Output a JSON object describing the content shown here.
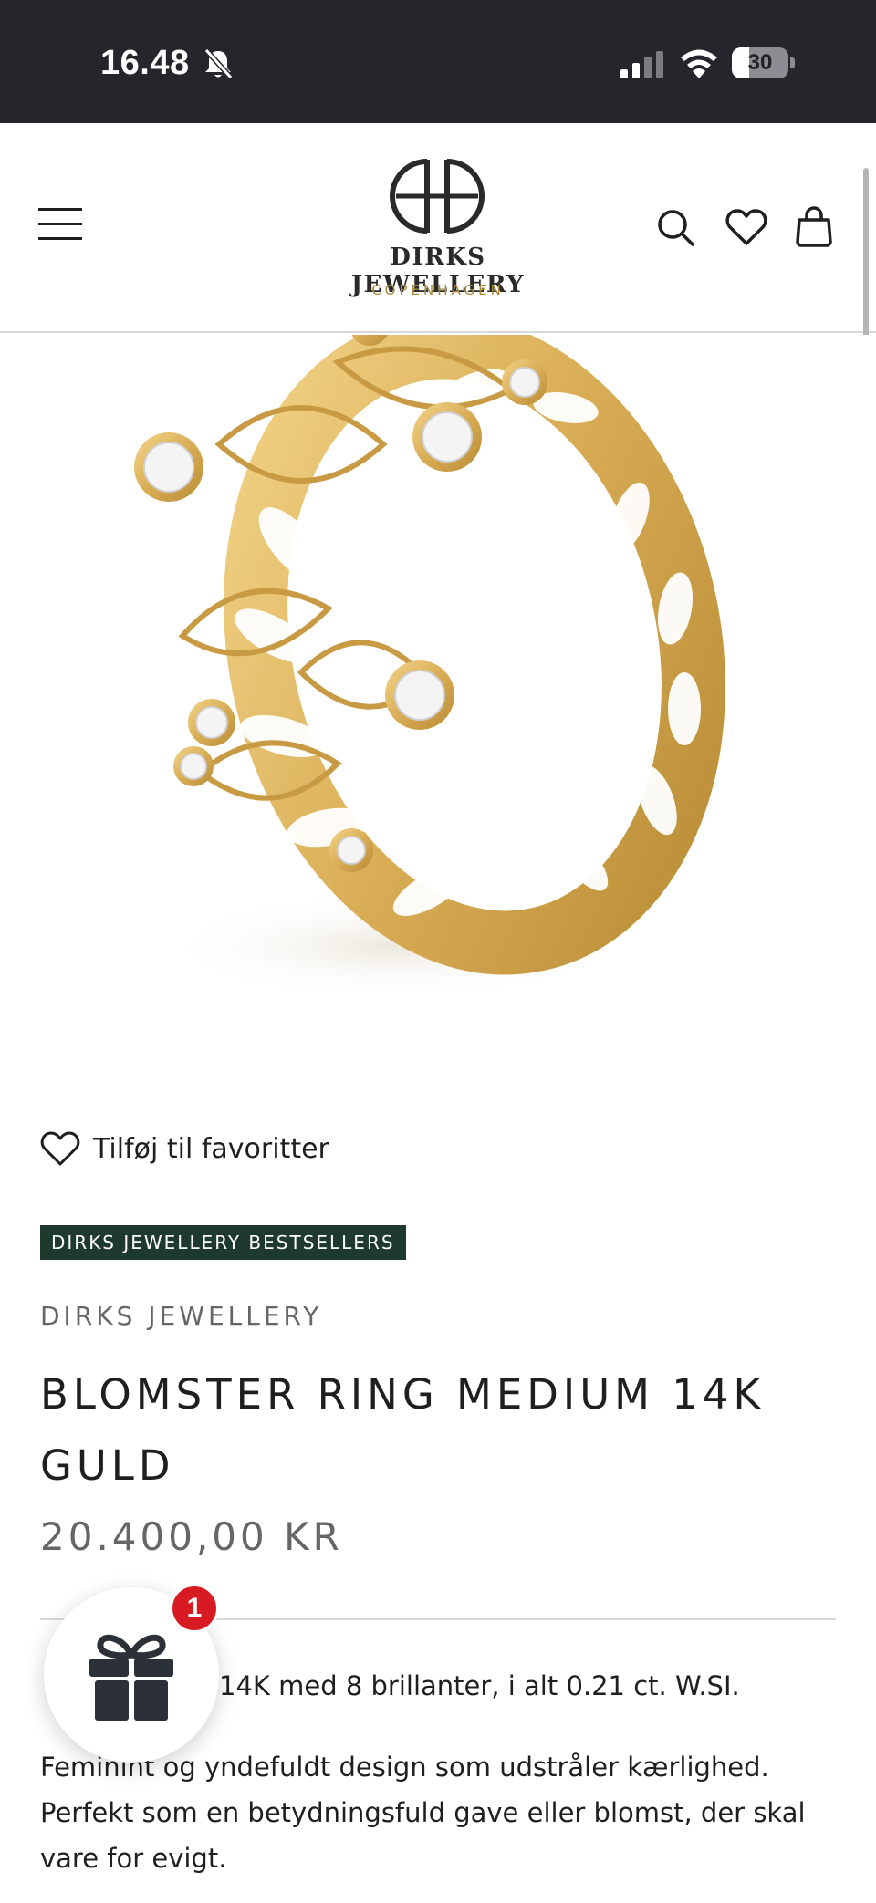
{
  "status_bar": {
    "time": "16.48",
    "battery_level": "30",
    "battery_fraction": 0.3
  },
  "header": {
    "logo_name": "DIRKS JEWELLERY",
    "logo_city": "COPENHAGEN",
    "icons": [
      "menu-icon",
      "search-icon",
      "heart-icon",
      "bag-icon"
    ]
  },
  "product": {
    "favorite_label": "Tilføj til favoritter",
    "collection_badge": "DIRKS JEWELLERY BESTSELLERS",
    "vendor": "DIRKS JEWELLERY",
    "title": "BLOMSTER RING MEDIUM 14K GULD",
    "price": "20.400,00 KR",
    "description_short": "14K med 8 brillanter, i alt 0.21 ct. W.SI.",
    "description_long": "Feminint og yndefuldt design som udstråler kærlighed. Perfekt som en betydningsfuld gave eller blomst, der skal vare for evigt."
  },
  "gift_widget": {
    "count": "1"
  },
  "colors": {
    "status_bar_bg": "#24262b",
    "badge_bg": "#1e3a2f",
    "logo_accent": "#a88a36",
    "gold": "#d9ad55",
    "notification_red": "#d81b23"
  }
}
